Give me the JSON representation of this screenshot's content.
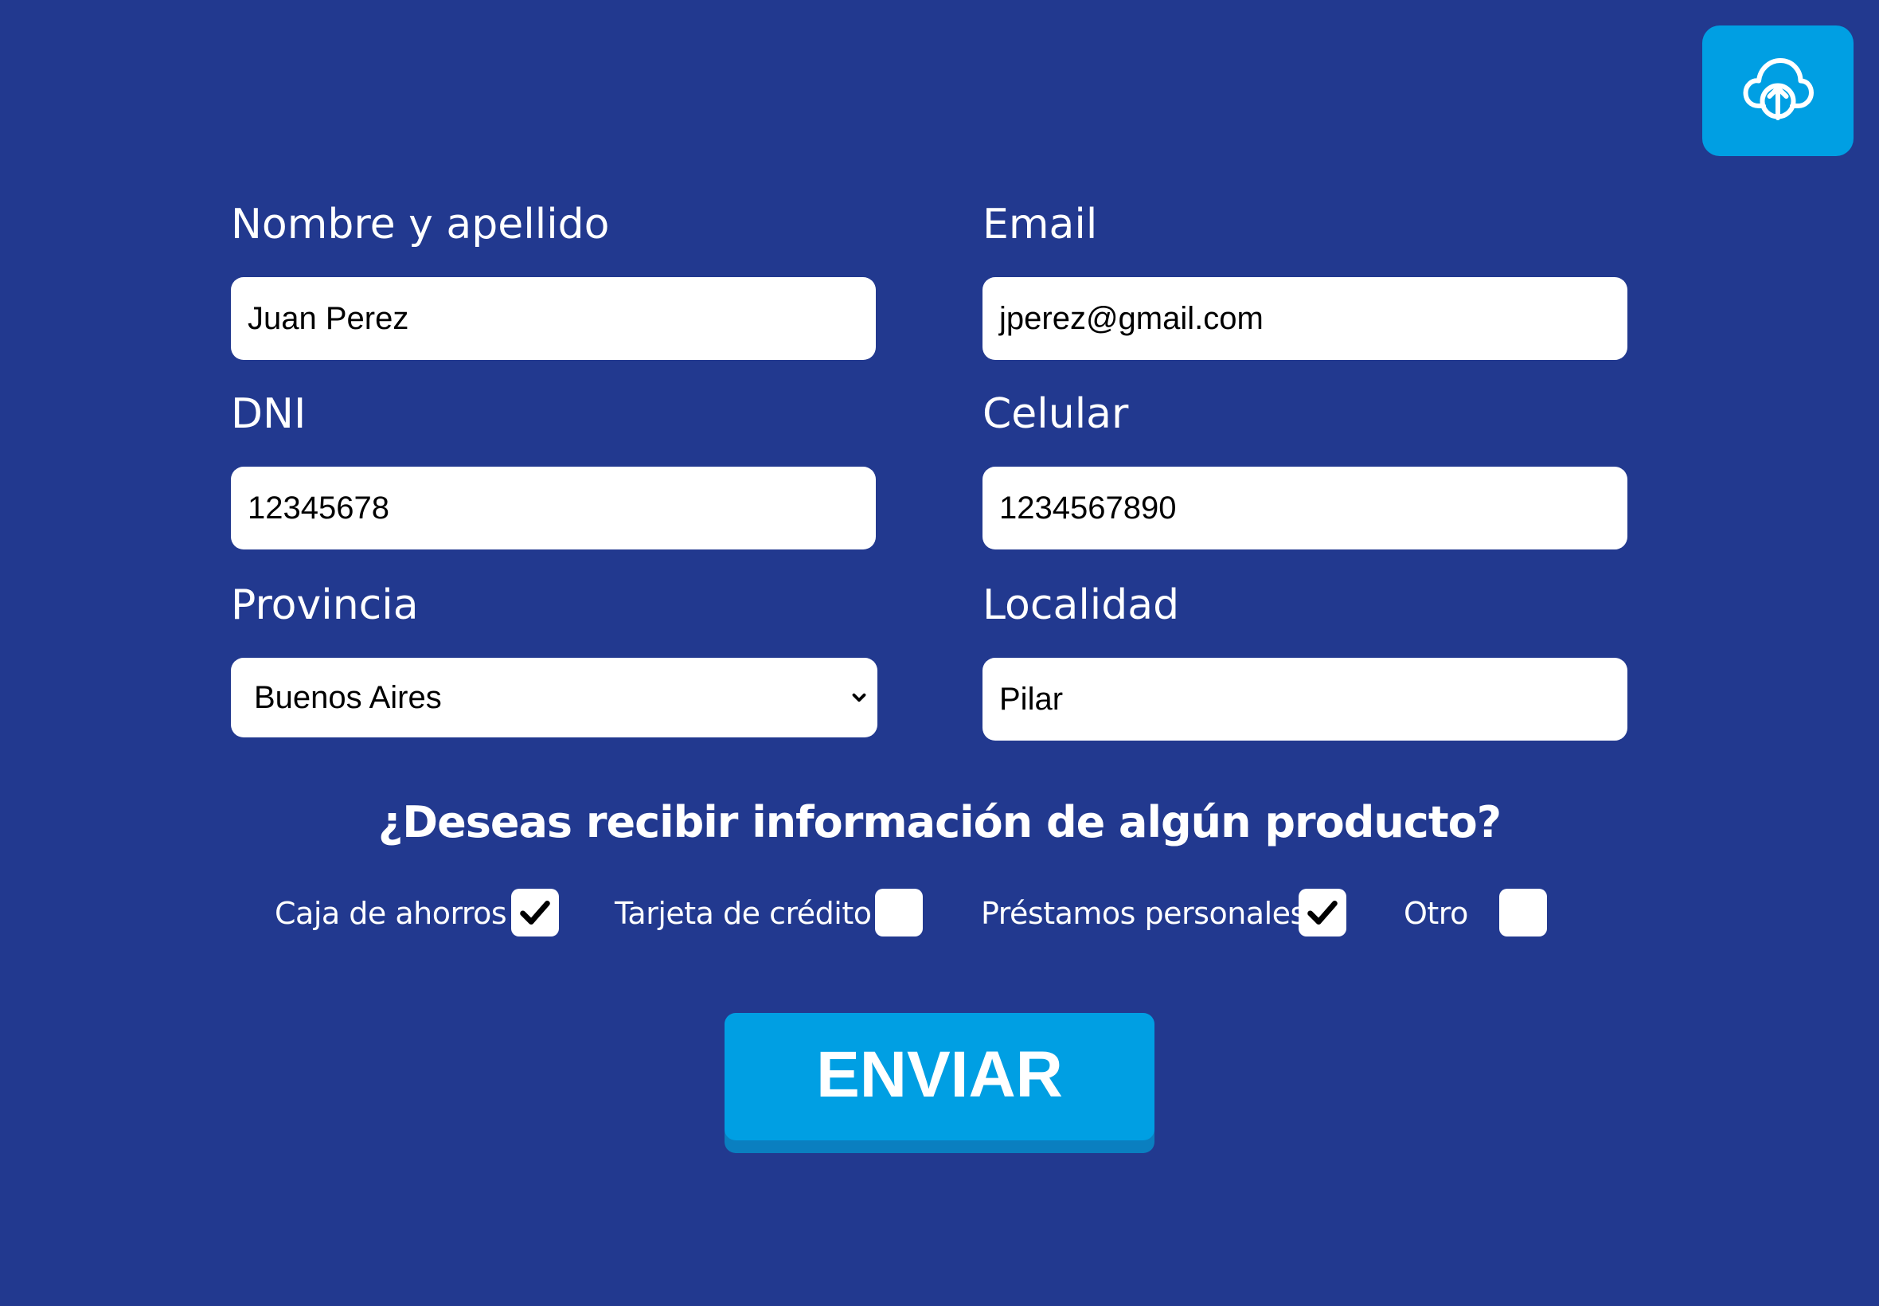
{
  "upload": {
    "icon": "cloud-upload-icon"
  },
  "form": {
    "name": {
      "label": "Nombre y apellido",
      "value": "Juan Perez"
    },
    "email": {
      "label": "Email",
      "value": "jperez@gmail.com"
    },
    "dni": {
      "label": "DNI",
      "value": "12345678"
    },
    "phone": {
      "label": "Celular",
      "value": "1234567890"
    },
    "province": {
      "label": "Provincia",
      "value": "Buenos Aires",
      "icon": "chevron-down-icon"
    },
    "locality": {
      "label": "Localidad",
      "value": "Pilar"
    }
  },
  "products": {
    "question": "¿Deseas recibir información de algún producto?",
    "options": [
      {
        "label": "Caja de ahorros",
        "checked": true
      },
      {
        "label": "Tarjeta de crédito",
        "checked": false
      },
      {
        "label": "Préstamos personales",
        "checked": true
      },
      {
        "label": "Otro",
        "checked": false
      }
    ]
  },
  "submit": {
    "label": "ENVIAR"
  },
  "colors": {
    "background": "#22398f",
    "accent": "#009fe3",
    "button_shadow": "#0a7fc0",
    "text": "#ffffff"
  }
}
